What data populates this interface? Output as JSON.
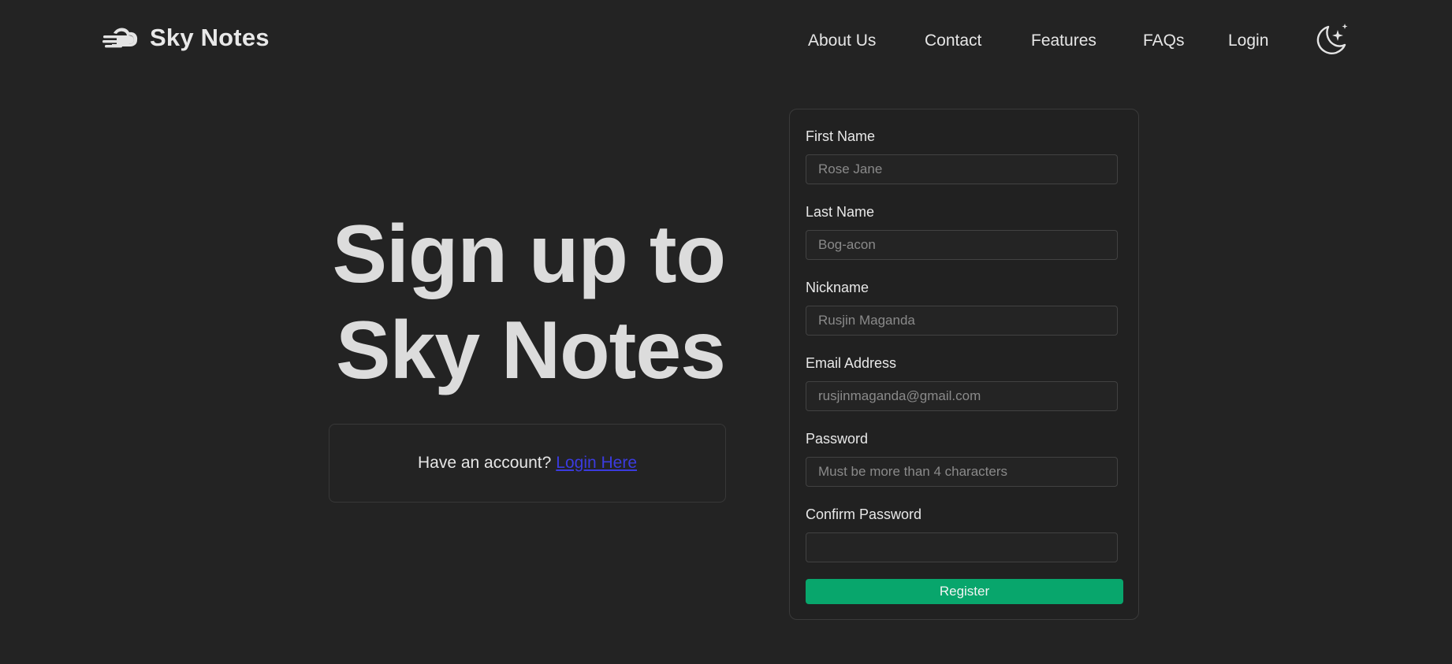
{
  "brand": {
    "name": "Sky Notes",
    "logo_icon": "cloud-icon"
  },
  "nav": {
    "items": [
      {
        "label": "About Us"
      },
      {
        "label": "Contact"
      },
      {
        "label": "Features"
      },
      {
        "label": "FAQs"
      },
      {
        "label": "Login"
      }
    ],
    "theme_icon": "moon-stars-icon"
  },
  "hero": {
    "title_line1": "Sign up to",
    "title_line2": "Sky Notes",
    "account_prompt": "Have an account?",
    "login_link": "Login Here"
  },
  "form": {
    "first_name": {
      "label": "First Name",
      "placeholder": "Rose Jane"
    },
    "last_name": {
      "label": "Last Name",
      "placeholder": "Bog-acon"
    },
    "nickname": {
      "label": "Nickname",
      "placeholder": "Rusjin Maganda"
    },
    "email": {
      "label": "Email Address",
      "placeholder": "rusjinmaganda@gmail.com"
    },
    "password": {
      "label": "Password",
      "placeholder": "Must be more than 4 characters"
    },
    "confirm_password": {
      "label": "Confirm Password",
      "placeholder": ""
    },
    "register_label": "Register"
  },
  "colors": {
    "background": "#232323",
    "register_button": "#08a66c",
    "link": "#3b3bdf"
  }
}
